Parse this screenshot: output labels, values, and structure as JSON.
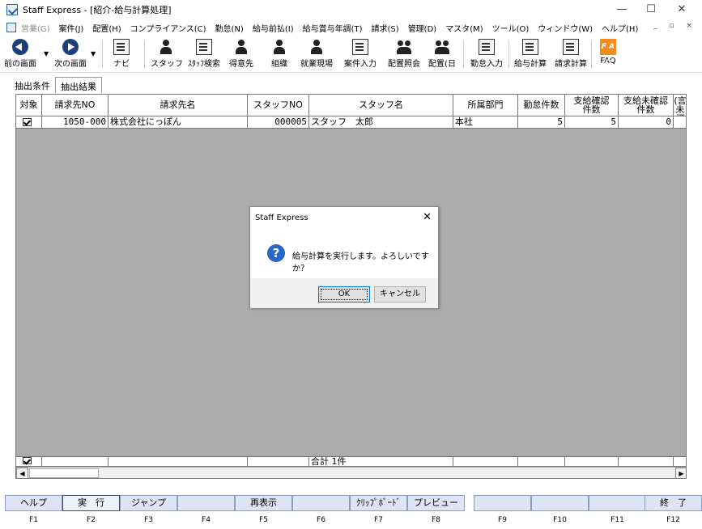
{
  "window": {
    "title": "Staff Express - [紹介-給与計算処理]",
    "controls": [
      "—",
      "☐",
      "✕"
    ],
    "mdi_controls": "_ ▫ ×"
  },
  "menu": [
    {
      "label": "営業(G)",
      "dim": true
    },
    {
      "label": "案件(J)"
    },
    {
      "label": "配置(H)"
    },
    {
      "label": "コンプライアンス(C)"
    },
    {
      "label": "勤怠(N)"
    },
    {
      "label": "給与前払(I)"
    },
    {
      "label": "給与賞与年調(T)"
    },
    {
      "label": "請求(S)"
    },
    {
      "label": "管理(D)"
    },
    {
      "label": "マスタ(M)"
    },
    {
      "label": "ツール(O)"
    },
    {
      "label": "ウィンドウ(W)"
    },
    {
      "label": "ヘルプ(H)"
    }
  ],
  "toolbar": [
    {
      "label": "前の画面",
      "icon": "back-arrow-icon"
    },
    {
      "label": "次の画面",
      "icon": "forward-arrow-icon"
    },
    {
      "label": "ナビ",
      "icon": "navi-icon"
    },
    {
      "label": "スタッフ",
      "icon": "staff-icon"
    },
    {
      "label": "ｽﾀｯﾌ検索",
      "icon": "staff-search-icon"
    },
    {
      "label": "得意先",
      "icon": "customer-icon"
    },
    {
      "label": "組織",
      "icon": "organization-icon"
    },
    {
      "label": "就業現場",
      "icon": "worksite-icon"
    },
    {
      "label": "案件入力",
      "icon": "job-entry-icon"
    },
    {
      "label": "配置照会",
      "icon": "placement-inquiry-icon"
    },
    {
      "label": "配置(日",
      "icon": "placement-daily-icon"
    },
    {
      "label": "勤怠入力",
      "icon": "attendance-entry-icon"
    },
    {
      "label": "給与計算",
      "icon": "payroll-icon"
    },
    {
      "label": "請求計算",
      "icon": "billing-icon"
    },
    {
      "label": "FAQ",
      "icon": "faq-icon",
      "icon_text": "F A Q"
    }
  ],
  "tabs": [
    {
      "label": "抽出条件"
    },
    {
      "label": "抽出結果",
      "active": true
    }
  ],
  "grid": {
    "headers": [
      "対象",
      "請求先NO",
      "請求先名",
      "スタッフNO",
      "スタッフ名",
      "所属部門",
      "勤怠件数",
      "支給確認\n件数",
      "支給未確認\n件数",
      "(言\n未打"
    ],
    "rows": [
      {
        "checked": true,
        "billing_no": "1050-000",
        "billing_name": "株式会社にっぽん",
        "staff_no": "000005",
        "staff_name": "スタッフ　太郎",
        "department": "本社",
        "attendance_count": "5",
        "confirmed_count": "5",
        "unconfirmed_count": "0"
      }
    ],
    "footer": {
      "total": "合計 1件"
    }
  },
  "dialog": {
    "title": "Staff Express",
    "message": "給与計算を実行します。よろしいですか？",
    "ok_label": "OK",
    "cancel_label": "キャンセル"
  },
  "fkeys": [
    {
      "label": "ヘルプ",
      "key": "F1"
    },
    {
      "label": "実　行",
      "key": "F2",
      "primary": true
    },
    {
      "label": "ジャンプ",
      "key": "F3"
    },
    {
      "label": "",
      "key": "F4"
    },
    {
      "label": "再表示",
      "key": "F5"
    },
    {
      "label": "",
      "key": "F6"
    },
    {
      "label": "ｸﾘｯﾌﾟﾎﾞｰﾄﾞ",
      "key": "F7"
    },
    {
      "label": "プレビュー",
      "key": "F8"
    },
    {
      "label": "",
      "key": "F9"
    },
    {
      "label": "",
      "key": "F10"
    },
    {
      "label": "",
      "key": "F11"
    },
    {
      "label": "終　了",
      "key": "F12"
    }
  ]
}
